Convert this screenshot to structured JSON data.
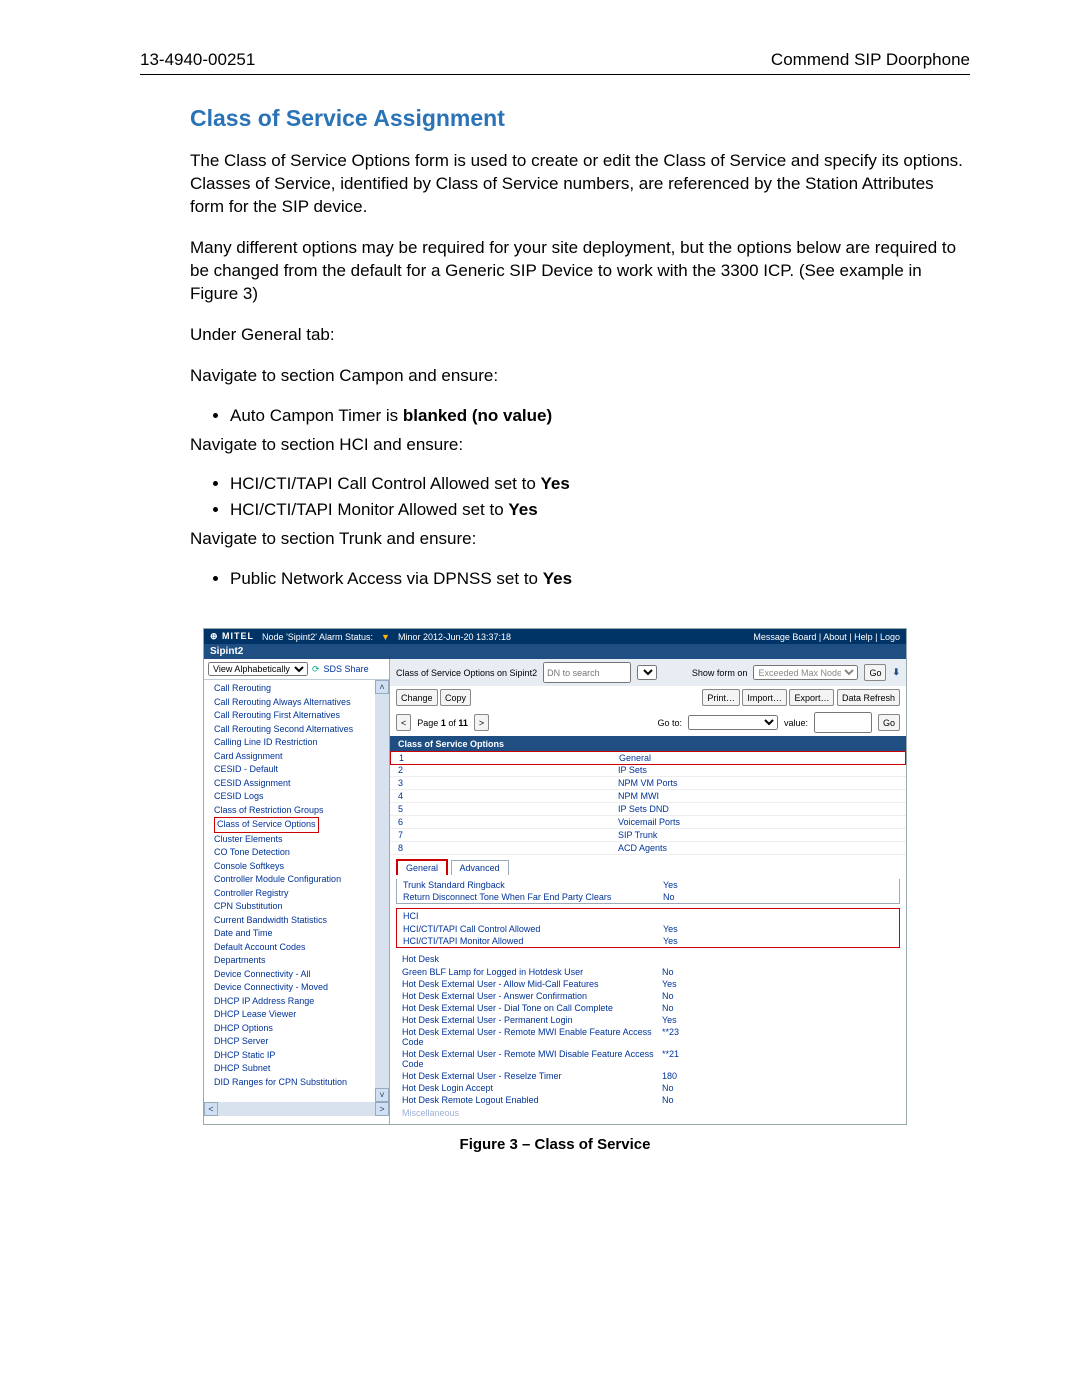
{
  "header": {
    "left": "13-4940-00251",
    "right": "Commend SIP Doorphone"
  },
  "title": "Class of Service Assignment",
  "para1": "The Class of Service Options form is used to create or edit the Class of Service and specify its options. Classes of Service, identified by Class of Service numbers, are referenced by the Station Attributes form for the SIP device.",
  "para2": "Many different options may be required for your site deployment, but the options below are required to be changed from the default for a Generic SIP Device to work with the 3300 ICP. (See example in Figure 3)",
  "under": "Under General tab:",
  "nav_campon": "Navigate to section Campon and ensure:",
  "bullet_campon_prefix": "Auto Campon Timer is ",
  "bullet_campon_strong": "blanked (no value)",
  "nav_hci": "Navigate to section HCI and ensure:",
  "bullets_hci": [
    "HCI/CTI/TAPI Call Control Allowed set to ",
    "HCI/CTI/TAPI Monitor Allowed set to "
  ],
  "yes": "Yes",
  "nav_trunk": "Navigate to section Trunk and ensure:",
  "bullet_trunk": "Public Network Access via DPNSS set to ",
  "figcap": "Figure 3 – Class of Service",
  "shot": {
    "brand": "MITEL",
    "node_label": "Node 'Sipint2' Alarm Status:",
    "alarm": "Minor 2012-Jun-20 13:37:18",
    "top_links": "Message Board  |  About  |  Help  |  Logo",
    "subbar": "Sipint2",
    "view_sel": "View Alphabetically",
    "sds": "SDS Share",
    "breadcrumb": "Class of Service Options on  Sipint2",
    "search_ph": "DN to search",
    "showform": "Show form on",
    "showform_val": "Exceeded Max Nodes",
    "go": "Go",
    "btns": {
      "change": "Change",
      "copy": "Copy",
      "print": "Print…",
      "import": "Import…",
      "export": "Export…",
      "refresh": "Data Refresh"
    },
    "pager": {
      "pre": "Page",
      "page": "1",
      "mid": "of",
      "total": "11",
      "goto": "Go to:",
      "value": "value:",
      "gobtn": "Go"
    },
    "band": "Class of Service Options",
    "cos": [
      {
        "n": "1",
        "l": "General"
      },
      {
        "n": "2",
        "l": "IP Sets"
      },
      {
        "n": "3",
        "l": "NPM VM Ports"
      },
      {
        "n": "4",
        "l": "NPM MWI"
      },
      {
        "n": "5",
        "l": "IP Sets DND"
      },
      {
        "n": "6",
        "l": "Voicemail Ports"
      },
      {
        "n": "7",
        "l": "SIP Trunk"
      },
      {
        "n": "8",
        "l": "ACD Agents"
      }
    ],
    "tabs": {
      "general": "General",
      "advanced": "Advanced"
    },
    "det_top": [
      {
        "k": "Trunk Standard Ringback",
        "v": "Yes"
      },
      {
        "k": "Return Disconnect Tone When Far End Party Clears",
        "v": "No"
      }
    ],
    "hci_title": "HCI",
    "hci_rows": [
      {
        "k": "HCI/CTI/TAPI Call Control Allowed",
        "v": "Yes"
      },
      {
        "k": "HCI/CTI/TAPI Monitor Allowed",
        "v": "Yes"
      }
    ],
    "hotdesk_title": "Hot Desk",
    "hotdesk_rows": [
      {
        "k": "Green BLF Lamp for Logged in Hotdesk User",
        "v": "No"
      },
      {
        "k": "Hot Desk External User - Allow Mid-Call Features",
        "v": "Yes"
      },
      {
        "k": "Hot Desk External User - Answer Confirmation",
        "v": "No"
      },
      {
        "k": "Hot Desk External User - Dial Tone on Call Complete",
        "v": "No"
      },
      {
        "k": "Hot Desk External User - Permanent Login",
        "v": "Yes"
      },
      {
        "k": "Hot Desk External User - Remote MWI Enable Feature Access Code",
        "v": "**23"
      },
      {
        "k": "Hot Desk External User - Remote MWI Disable Feature Access Code",
        "v": "**21"
      },
      {
        "k": "Hot Desk External User - Reselze Timer",
        "v": "180"
      },
      {
        "k": "Hot Desk Login Accept",
        "v": "No"
      },
      {
        "k": "Hot Desk Remote Logout Enabled",
        "v": "No"
      }
    ],
    "misc": "Miscellaneous",
    "nav_items": [
      "Call Rerouting",
      "Call Rerouting Always Alternatives",
      "Call Rerouting First Alternatives",
      "Call Rerouting Second Alternatives",
      "Calling Line ID Restriction",
      "Card Assignment",
      "CESID - Default",
      "CESID Assignment",
      "CESID Logs",
      "Class of Restriction Groups",
      "Class of Service Options",
      "Cluster Elements",
      "CO Tone Detection",
      "Console Softkeys",
      "Controller Module Configuration",
      "Controller Registry",
      "CPN Substitution",
      "Current Bandwidth Statistics",
      "Date and Time",
      "Default Account Codes",
      "Departments",
      "Device Connectivity - All",
      "Device Connectivity - Moved",
      "DHCP IP Address Range",
      "DHCP Lease Viewer",
      "DHCP Options",
      "DHCP Server",
      "DHCP Static IP",
      "DHCP Subnet",
      "DID Ranges for CPN Substitution"
    ],
    "nav_active_index": 10
  }
}
